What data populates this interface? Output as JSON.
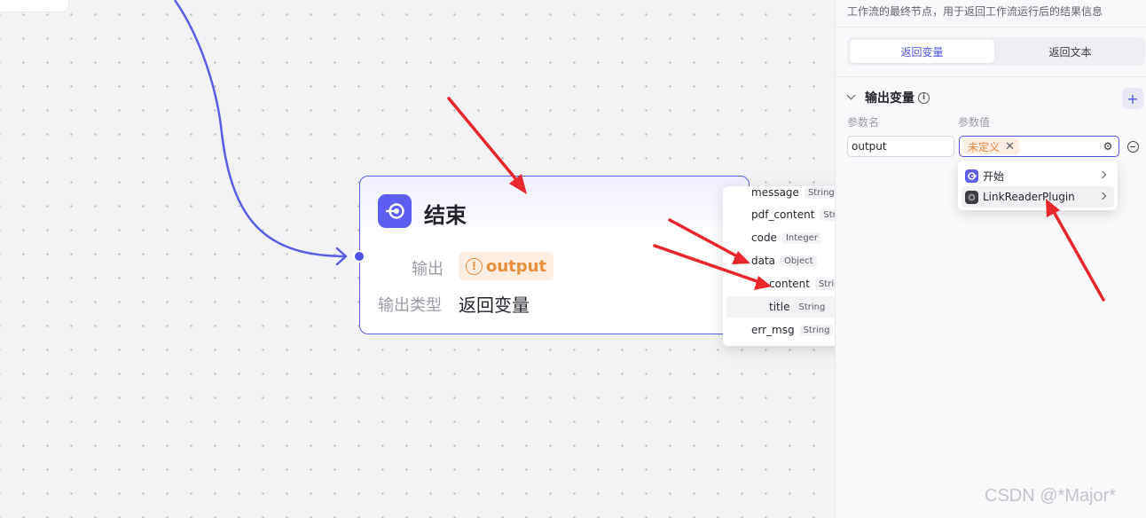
{
  "canvas": {
    "end_node": {
      "title": "结束",
      "output_label": "输出",
      "output_value": "output",
      "type_label": "输出类型",
      "type_value": "返回变量"
    },
    "variable_tree": {
      "items": [
        {
          "name": "message",
          "type": "String"
        },
        {
          "name": "pdf_content",
          "type": "String"
        },
        {
          "name": "code",
          "type": "Integer"
        },
        {
          "name": "data",
          "type": "Object"
        },
        {
          "name": "content",
          "type": "String"
        },
        {
          "name": "title",
          "type": "String"
        },
        {
          "name": "err_msg",
          "type": "String"
        }
      ]
    }
  },
  "panel": {
    "description": "工作流的最终节点，用于返回工作流运行后的结果信息",
    "tabs": [
      {
        "label": "返回变量",
        "active": true
      },
      {
        "label": "返回文本",
        "active": false
      }
    ],
    "section_title": "输出变量",
    "col_name_label": "参数名",
    "col_value_label": "参数值",
    "param_name": "output",
    "param_value_tag": "未定义",
    "source_menu": [
      {
        "label": "开始",
        "icon": "start-icon"
      },
      {
        "label": "LinkReaderPlugin",
        "icon": "plugin-icon"
      }
    ]
  },
  "watermark": "CSDN @*Major*",
  "colors": {
    "accent": "#4d53e8",
    "warning": "#ea8d3b",
    "annotation": "#e8262b"
  }
}
